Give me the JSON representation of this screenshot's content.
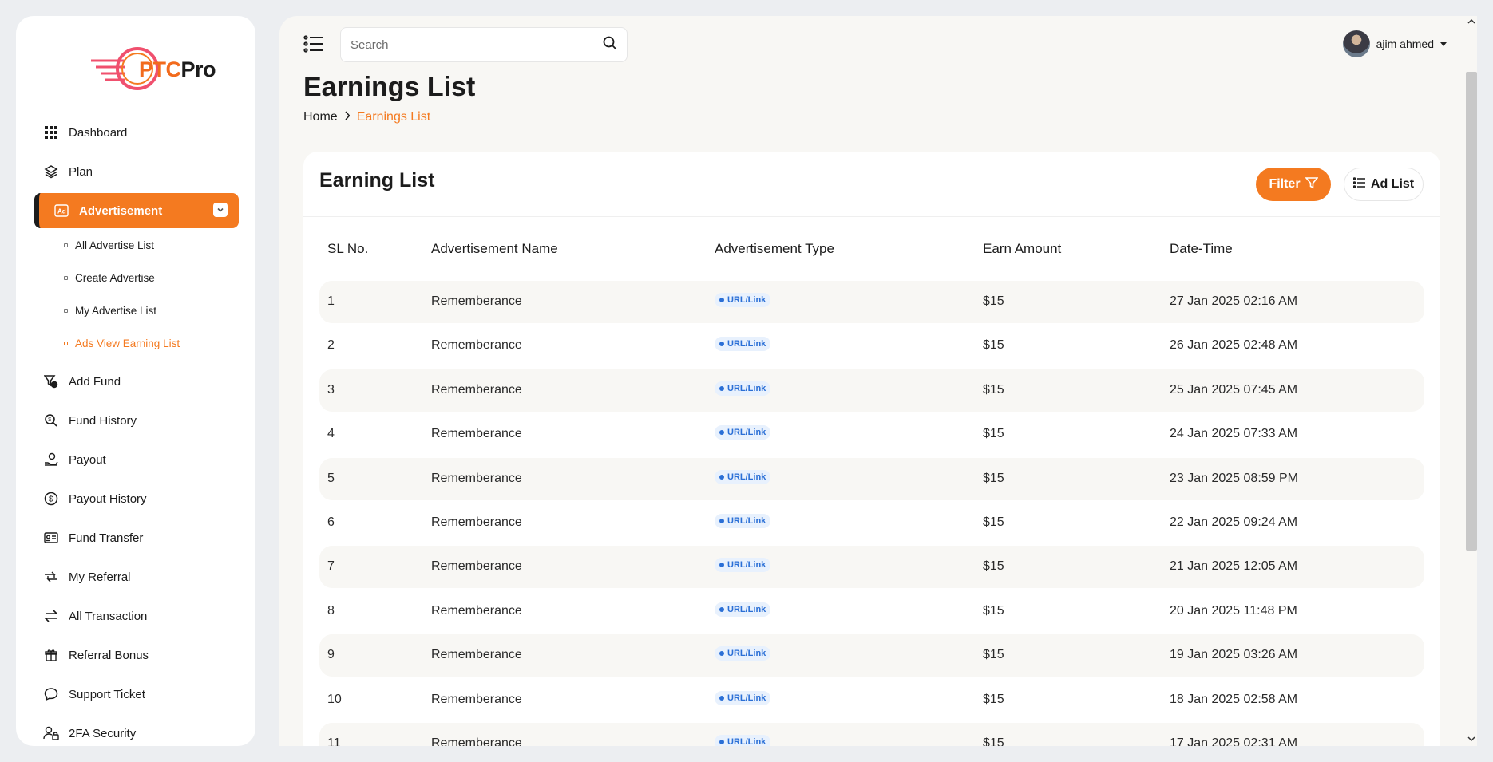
{
  "logo": {
    "ptc": "PTC",
    "pro": "Pro"
  },
  "sidebar": {
    "items": [
      {
        "label": "Dashboard",
        "icon": "grid-icon"
      },
      {
        "label": "Plan",
        "icon": "layers-icon"
      },
      {
        "label": "Advertisement",
        "icon": "ad-icon",
        "active": true
      },
      {
        "label": "Add Fund",
        "icon": "funnel-dollar-icon"
      },
      {
        "label": "Fund History",
        "icon": "search-dollar-icon"
      },
      {
        "label": "Payout",
        "icon": "hand-coin-icon"
      },
      {
        "label": "Payout History",
        "icon": "dollar-circle-icon"
      },
      {
        "label": "Fund Transfer",
        "icon": "id-card-icon"
      },
      {
        "label": "My Referral",
        "icon": "repeat-icon"
      },
      {
        "label": "All Transaction",
        "icon": "arrows-exchange-icon"
      },
      {
        "label": "Referral Bonus",
        "icon": "gift-icon"
      },
      {
        "label": "Support Ticket",
        "icon": "chat-icon"
      },
      {
        "label": "2FA Security",
        "icon": "user-lock-icon"
      }
    ],
    "sub_items": [
      {
        "label": "All Advertise List"
      },
      {
        "label": "Create Advertise"
      },
      {
        "label": "My Advertise List"
      },
      {
        "label": "Ads View Earning List",
        "current": true
      }
    ]
  },
  "topbar": {
    "search_placeholder": "Search",
    "user_name": "ajim ahmed"
  },
  "page": {
    "title": "Earnings List",
    "breadcrumb_home": "Home",
    "breadcrumb_current": "Earnings List"
  },
  "card": {
    "title": "Earning List",
    "filter_label": "Filter",
    "adlist_label": "Ad List",
    "columns": [
      "SL No.",
      "Advertisement Name",
      "Advertisement Type",
      "Earn Amount",
      "Date-Time"
    ],
    "rows": [
      [
        "1",
        "Rememberance",
        "URL/Link",
        "$15",
        "27 Jan 2025 02:16 AM"
      ],
      [
        "2",
        "Rememberance",
        "URL/Link",
        "$15",
        "26 Jan 2025 02:48 AM"
      ],
      [
        "3",
        "Rememberance",
        "URL/Link",
        "$15",
        "25 Jan 2025 07:45 AM"
      ],
      [
        "4",
        "Rememberance",
        "URL/Link",
        "$15",
        "24 Jan 2025 07:33 AM"
      ],
      [
        "5",
        "Rememberance",
        "URL/Link",
        "$15",
        "23 Jan 2025 08:59 PM"
      ],
      [
        "6",
        "Rememberance",
        "URL/Link",
        "$15",
        "22 Jan 2025 09:24 AM"
      ],
      [
        "7",
        "Rememberance",
        "URL/Link",
        "$15",
        "21 Jan 2025 12:05 AM"
      ],
      [
        "8",
        "Rememberance",
        "URL/Link",
        "$15",
        "20 Jan 2025 11:48 PM"
      ],
      [
        "9",
        "Rememberance",
        "URL/Link",
        "$15",
        "19 Jan 2025 03:26 AM"
      ],
      [
        "10",
        "Rememberance",
        "URL/Link",
        "$15",
        "18 Jan 2025 02:58 AM"
      ],
      [
        "11",
        "Rememberance",
        "URL/Link",
        "$15",
        "17 Jan 2025 02:31 AM"
      ]
    ]
  },
  "colors": {
    "accent": "#f47a20",
    "badge_text": "#2a6fd6",
    "badge_bg": "#e8f1fd"
  }
}
